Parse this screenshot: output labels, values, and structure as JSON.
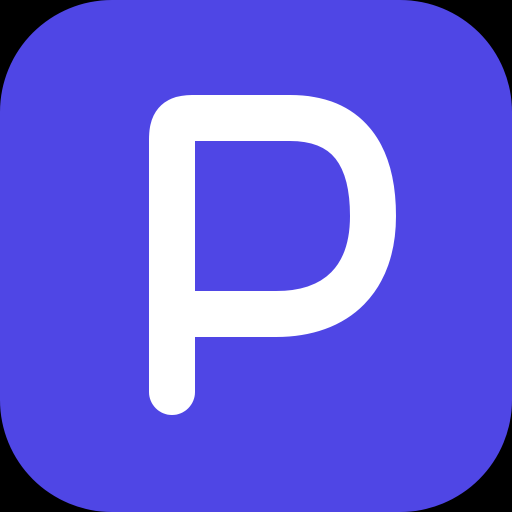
{
  "icon": {
    "name": "p-letter-app-icon",
    "glyph": "P",
    "background_color": "#4f46e5",
    "glyph_color": "#ffffff",
    "outer_background": "#000000"
  }
}
